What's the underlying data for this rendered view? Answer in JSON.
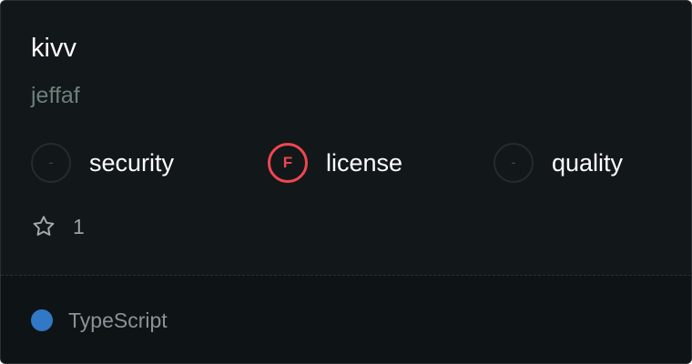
{
  "repo": {
    "name": "kivv",
    "owner": "jeffaf"
  },
  "metrics": [
    {
      "grade": "-",
      "label": "security",
      "status": "none"
    },
    {
      "grade": "F",
      "label": "license",
      "status": "fail"
    },
    {
      "grade": "-",
      "label": "quality",
      "status": "none"
    }
  ],
  "stars": {
    "icon": "star-outline-icon",
    "count": "1"
  },
  "language": {
    "name": "TypeScript",
    "color": "#3178c6"
  },
  "colors": {
    "fail": "#f0464f",
    "background": "#12171a"
  }
}
